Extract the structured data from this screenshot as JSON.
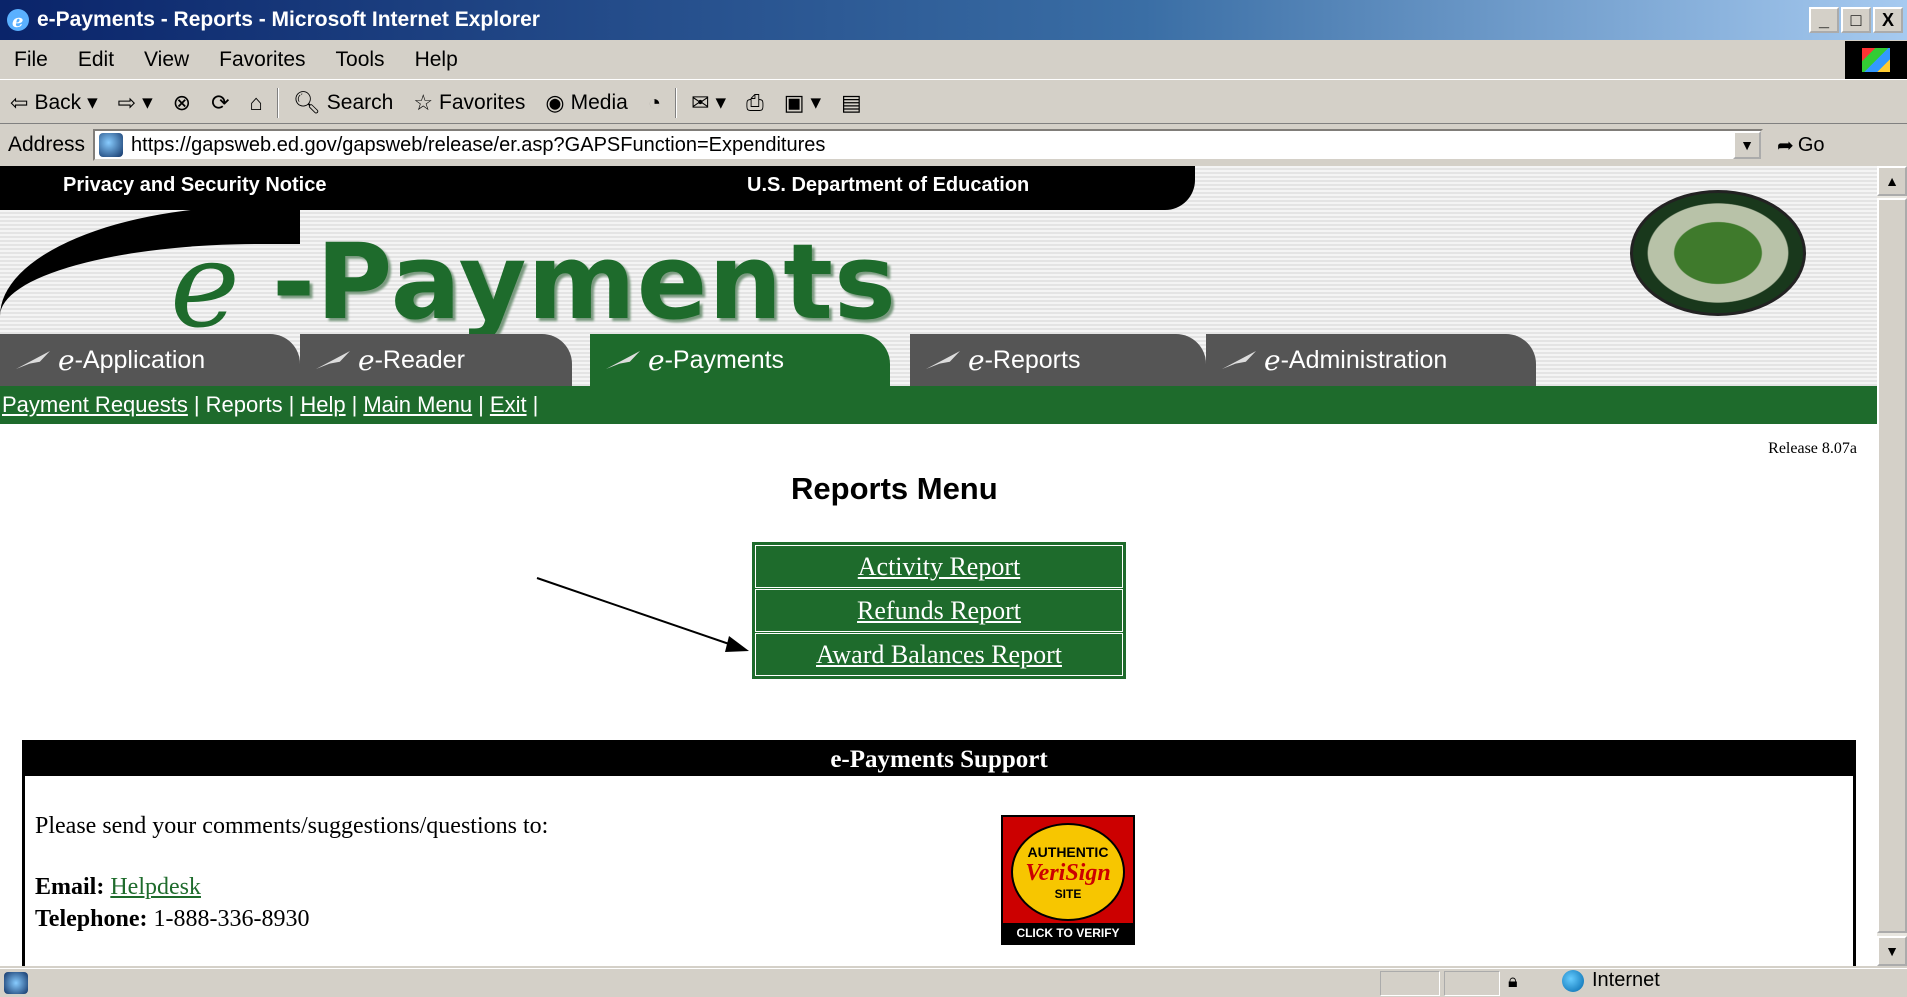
{
  "window": {
    "title": "e-Payments - Reports - Microsoft Internet Explorer",
    "minimize": "_",
    "maximize": "□",
    "close": "X"
  },
  "menu": [
    "File",
    "Edit",
    "View",
    "Favorites",
    "Tools",
    "Help"
  ],
  "toolbar": {
    "back": "Back",
    "search": "Search",
    "favorites": "Favorites",
    "media": "Media"
  },
  "address": {
    "label": "Address",
    "url": "https://gapsweb.ed.gov/gapsweb/release/er.asp?GAPSFunction=Expenditures",
    "go": "Go"
  },
  "banner": {
    "privacy": "Privacy and Security Notice",
    "department": "U.S. Department of Education",
    "logo_e": "e",
    "logo_rest": "-Payments"
  },
  "tabs": [
    {
      "e": "e",
      "label": "-Application"
    },
    {
      "e": "e",
      "label": "-Reader"
    },
    {
      "e": "e",
      "label": "-Payments"
    },
    {
      "e": "e",
      "label": "-Reports"
    },
    {
      "e": "e",
      "label": "-Administration"
    }
  ],
  "nav": {
    "payment_requests": "Payment Requests",
    "reports": "Reports",
    "help": "Help",
    "main_menu": "Main Menu",
    "exit": "Exit",
    "sep": "|"
  },
  "release": "Release 8.07a",
  "reports_title": "Reports Menu",
  "report_items": [
    "Activity Report",
    "Refunds Report",
    "Award Balances Report"
  ],
  "support": {
    "heading": "e-Payments Support",
    "text": "Please send your comments/suggestions/questions to:",
    "email_label": "Email:",
    "email_link": "Helpdesk",
    "phone_label": "Telephone:",
    "phone": "1-888-336-8930"
  },
  "verisign": {
    "top": "AUTHENTIC",
    "brand": "VeriSign",
    "site": "SITE",
    "bottom": "CLICK TO VERIFY"
  },
  "status": {
    "zone": "Internet"
  }
}
